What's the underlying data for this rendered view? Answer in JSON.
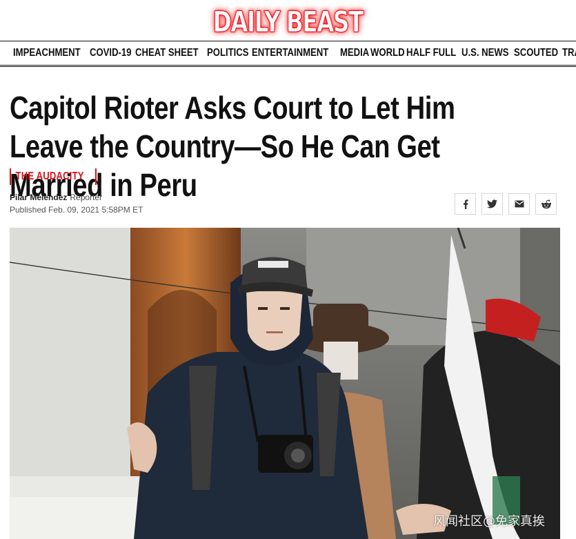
{
  "brand": {
    "name": "DAILY BEAST",
    "accent_color": "#e2101a"
  },
  "nav": {
    "items": [
      "IMPEACHMENT",
      "COVID-19",
      "CHEAT SHEET",
      "POLITICS",
      "ENTERTAINMENT",
      "MEDIA",
      "WORLD",
      "HALF FULL",
      "U.S. NEWS",
      "SCOUTED",
      "TRAVEL"
    ]
  },
  "article": {
    "headline": "Capitol Rioter Asks Court to Let Him Leave the Country—So He Can Get Married in Peru",
    "kicker": "THE AUDACITY",
    "author": "Pilar Melendez",
    "author_role": "Reporter",
    "published": "Published Feb. 09, 2021 5:58PM ET"
  },
  "share": {
    "buttons": [
      {
        "icon": "facebook-icon"
      },
      {
        "icon": "twitter-icon"
      },
      {
        "icon": "email-icon"
      },
      {
        "icon": "reddit-icon"
      }
    ]
  },
  "photo": {
    "watermark": "风闻社区@免家真挨"
  }
}
